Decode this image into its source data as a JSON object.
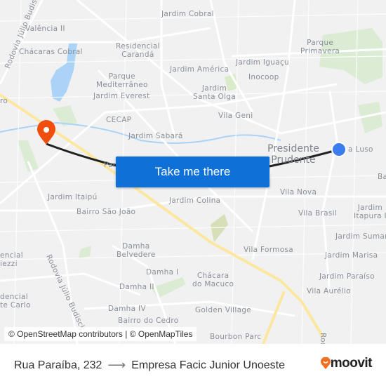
{
  "map": {
    "labels": {
      "jardim_cobral": "Jardim Cobral",
      "valencia_ii": "Valência II",
      "residencial_caranda": "Residencial\nCarandá",
      "chacaras_cobral": "Chácaras Cobral",
      "rodovia_top": "Rodovia Júlio Budisk",
      "parque_primavera": "Parque\nPrimavera",
      "jardim_iguacu": "Jardim Iguaçu",
      "jardim_america": "Jardim América",
      "inocoop": "Inocoop",
      "parque_mediterraneo": "Parque\nMediterrâneo",
      "jardim_everest": "Jardim Everest",
      "jardim_santa_olga": "Jardim\nSanta Olga",
      "vila_geni": "Vila Geni",
      "cecap": "CECAP",
      "jardim_sabara": "Jardim Sabará",
      "presidente_prudente": "Presidente\nPrudente",
      "vila_luso": "a Luso",
      "ba": "Ba",
      "par": "Par",
      "ro": "ro",
      "vila_nova": "Vila Nova",
      "jardim_itaipu": "Jardim Itaipú",
      "jardim_colina": "Jardim Colina",
      "vila_brasil": "Vila Brasil",
      "jardim_itapura": "Jardim\nItapura I",
      "bairro_sao_joao": "Bairro São João",
      "jardim_sumare": "Jardim Sumar",
      "damha_belvedere": "Damha\nBelvedere",
      "vila_formosa": "Vila Formosa",
      "jardim_marisa": "Jardim Marisa",
      "residencial_fiezzi": "encial\niezzi",
      "rodovia_bottom": "Rodovia Júlio Budisck",
      "damha_i": "Damha I",
      "chacara_macuco": "Chácara\ndo Macuco",
      "jardim_paraiso": "Jardim Paraíso",
      "damha_ii": "Damha II",
      "vila_aurelio": "Vila Aurélio",
      "residencial_monte_carlo": "dencial\nte Carlo",
      "damha_iv": "Damha IV",
      "golden_village": "Golden Village",
      "bairro_do_cedro": "Bairro do Cedro",
      "bourbon_parc": "Bourbon Parc",
      "rod": "Rod"
    },
    "cta_label": "Take me there",
    "attribution": "© OpenStreetMap contributors | © OpenMapTiles",
    "origin_marker_color": "#3b7ded",
    "destination_marker_color": "#f04e0f",
    "route_line_color": "#222222"
  },
  "footer": {
    "origin": "Rua Paraíba, 232",
    "arrow_icon": "arrow-right-icon",
    "destination": "Empresa Facic Junior Unoeste",
    "logo": "moovit",
    "logo_color": "#f36f21"
  }
}
